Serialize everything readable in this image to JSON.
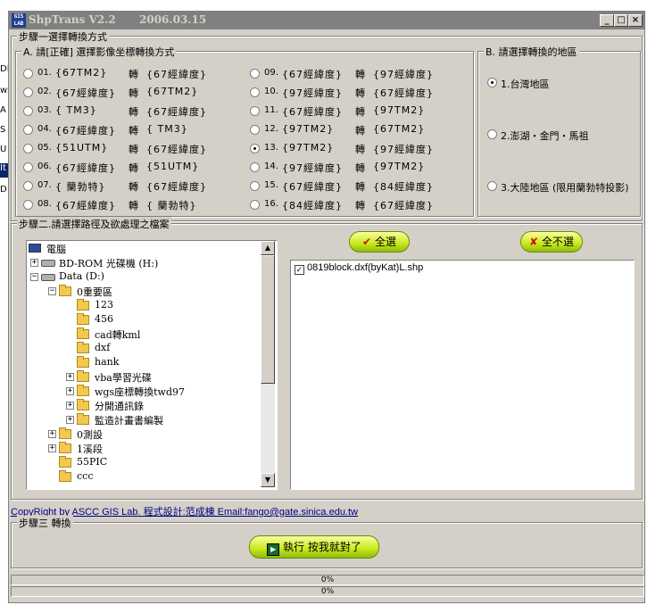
{
  "window": {
    "title": "ShpTrans V2.2",
    "date": "2006.03.15",
    "minimize_glyph": "_",
    "maximize_glyph": "□",
    "close_glyph": "×"
  },
  "background_fragments": [
    "DE",
    "w:",
    "A",
    "S",
    "U",
    "It",
    "D"
  ],
  "step1": {
    "legend": "步驟一選擇轉換方式",
    "conv_legend": "A. 請[正確] 選擇影像坐標轉換方式",
    "to_word": "轉",
    "conversions": [
      {
        "num": "01.",
        "from": "{67TM2}",
        "to": "{67經緯度}",
        "selected": false
      },
      {
        "num": "02.",
        "from": "{67經緯度}",
        "to": "{67TM2}",
        "selected": false
      },
      {
        "num": "03.",
        "from": "{  TM3}",
        "to": "{67經緯度}",
        "selected": false
      },
      {
        "num": "04.",
        "from": "{67經緯度}",
        "to": "{  TM3}",
        "selected": false
      },
      {
        "num": "05.",
        "from": "{51UTM}",
        "to": "{67經緯度}",
        "selected": false
      },
      {
        "num": "06.",
        "from": "{67經緯度}",
        "to": "{51UTM}",
        "selected": false
      },
      {
        "num": "07.",
        "from": "{  蘭勃特}",
        "to": "{67經緯度}",
        "selected": false
      },
      {
        "num": "08.",
        "from": "{67經緯度}",
        "to": "{  蘭勃特}",
        "selected": false
      },
      {
        "num": "09.",
        "from": "{67經緯度}",
        "to": "{97經緯度}",
        "selected": false
      },
      {
        "num": "10.",
        "from": "{97經緯度}",
        "to": "{67經緯度}",
        "selected": false
      },
      {
        "num": "11.",
        "from": "{67經緯度}",
        "to": "{97TM2}",
        "selected": false
      },
      {
        "num": "12.",
        "from": "{97TM2}",
        "to": "{67TM2}",
        "selected": false
      },
      {
        "num": "13.",
        "from": "{97TM2}",
        "to": "{97經緯度}",
        "selected": true
      },
      {
        "num": "14.",
        "from": "{97經緯度}",
        "to": "{97TM2}",
        "selected": false
      },
      {
        "num": "15.",
        "from": "{67經緯度}",
        "to": "{84經緯度}",
        "selected": false
      },
      {
        "num": "16.",
        "from": "{84經緯度}",
        "to": "{67經緯度}",
        "selected": false
      }
    ],
    "region_legend": "B. 請選擇轉換的地區",
    "regions": [
      {
        "label": "1.台灣地區",
        "selected": true
      },
      {
        "label": "2.澎湖・金門・馬祖",
        "selected": false
      },
      {
        "label": "3.大陸地區 (限用蘭勃特投影)",
        "selected": false
      }
    ]
  },
  "step2": {
    "legend": "步驟二.請選擇路徑及欲處理之檔案",
    "tree": [
      {
        "label": "電腦",
        "level": 0,
        "icon": "computer-icon",
        "expander": ""
      },
      {
        "label": "BD-ROM 光碟機 (H:)",
        "level": 1,
        "icon": "cdrom-icon",
        "expander": "+"
      },
      {
        "label": "Data (D:)",
        "level": 1,
        "icon": "drive-icon",
        "expander": "-"
      },
      {
        "label": "0重要區",
        "level": 2,
        "icon": "folder-icon",
        "expander": "-"
      },
      {
        "label": "123",
        "level": 3,
        "icon": "folder-icon",
        "expander": ""
      },
      {
        "label": "456",
        "level": 3,
        "icon": "folder-icon",
        "expander": ""
      },
      {
        "label": "cad轉kml",
        "level": 3,
        "icon": "folder-icon",
        "expander": ""
      },
      {
        "label": "dxf",
        "level": 3,
        "icon": "folder-icon",
        "expander": ""
      },
      {
        "label": "hank",
        "level": 3,
        "icon": "folder-icon",
        "expander": ""
      },
      {
        "label": "vba學習光碟",
        "level": 3,
        "icon": "folder-icon",
        "expander": "+"
      },
      {
        "label": "wgs座標轉換twd97",
        "level": 3,
        "icon": "folder-icon",
        "expander": "+"
      },
      {
        "label": "分開通訊錄",
        "level": 3,
        "icon": "folder-icon",
        "expander": "+"
      },
      {
        "label": "監造計畫書編製",
        "level": 3,
        "icon": "folder-icon",
        "expander": "+"
      },
      {
        "label": "0測設",
        "level": 2,
        "icon": "folder-icon",
        "expander": "+"
      },
      {
        "label": "1溪段",
        "level": 2,
        "icon": "folder-icon",
        "expander": "+"
      },
      {
        "label": "55PIC",
        "level": 2,
        "icon": "folder-icon",
        "expander": ""
      },
      {
        "label": "ccc",
        "level": 2,
        "icon": "folder-icon",
        "expander": ""
      }
    ],
    "select_all_label": "全選",
    "deselect_all_label": "全不選",
    "files": [
      {
        "label": "0819block.dxf(byKat)L.shp",
        "checked": true
      }
    ],
    "check_glyph": "✓"
  },
  "copyright": "CopyRight by ASCC GIS Lab. 程式設計:范成棟  Email:fango@gate.sinica.edu.tw",
  "step3": {
    "legend": "步驟三 轉換",
    "run_label": "執行 按我就對了"
  },
  "progress": {
    "overall_label": "0%",
    "overall_value": 0,
    "file_label": "0%",
    "file_value": 0
  },
  "colors": {
    "face": "#d4d0c8",
    "titlebar_inactive": "#808080",
    "link": "#000080",
    "button_green": "#c9e81a"
  }
}
